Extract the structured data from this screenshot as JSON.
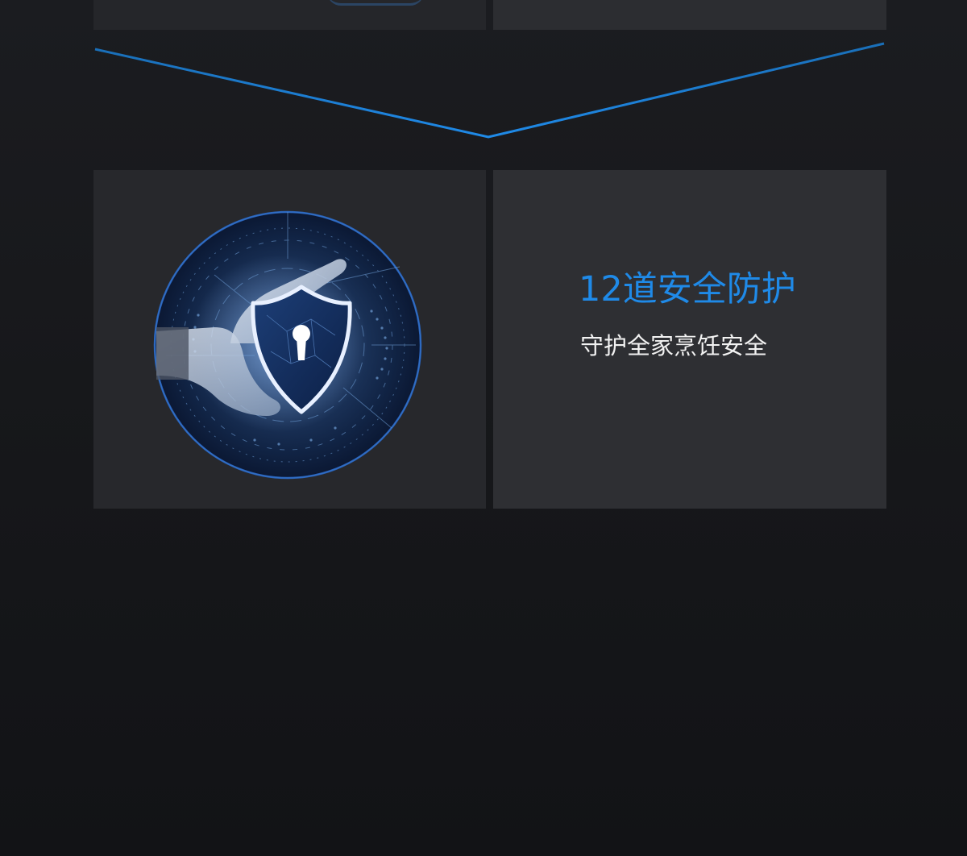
{
  "feature": {
    "title": "12道安全防护",
    "subtitle": "守护全家烹饪安全"
  },
  "icons": {
    "illustration": "shield-lock-icon",
    "divider": "chevron-down-icon"
  },
  "colors": {
    "background": "#17181b",
    "accent": "#1f8ae8",
    "tile_dark": "#27282c",
    "tile_light": "#2e2f33",
    "text": "#f2f2f2"
  }
}
